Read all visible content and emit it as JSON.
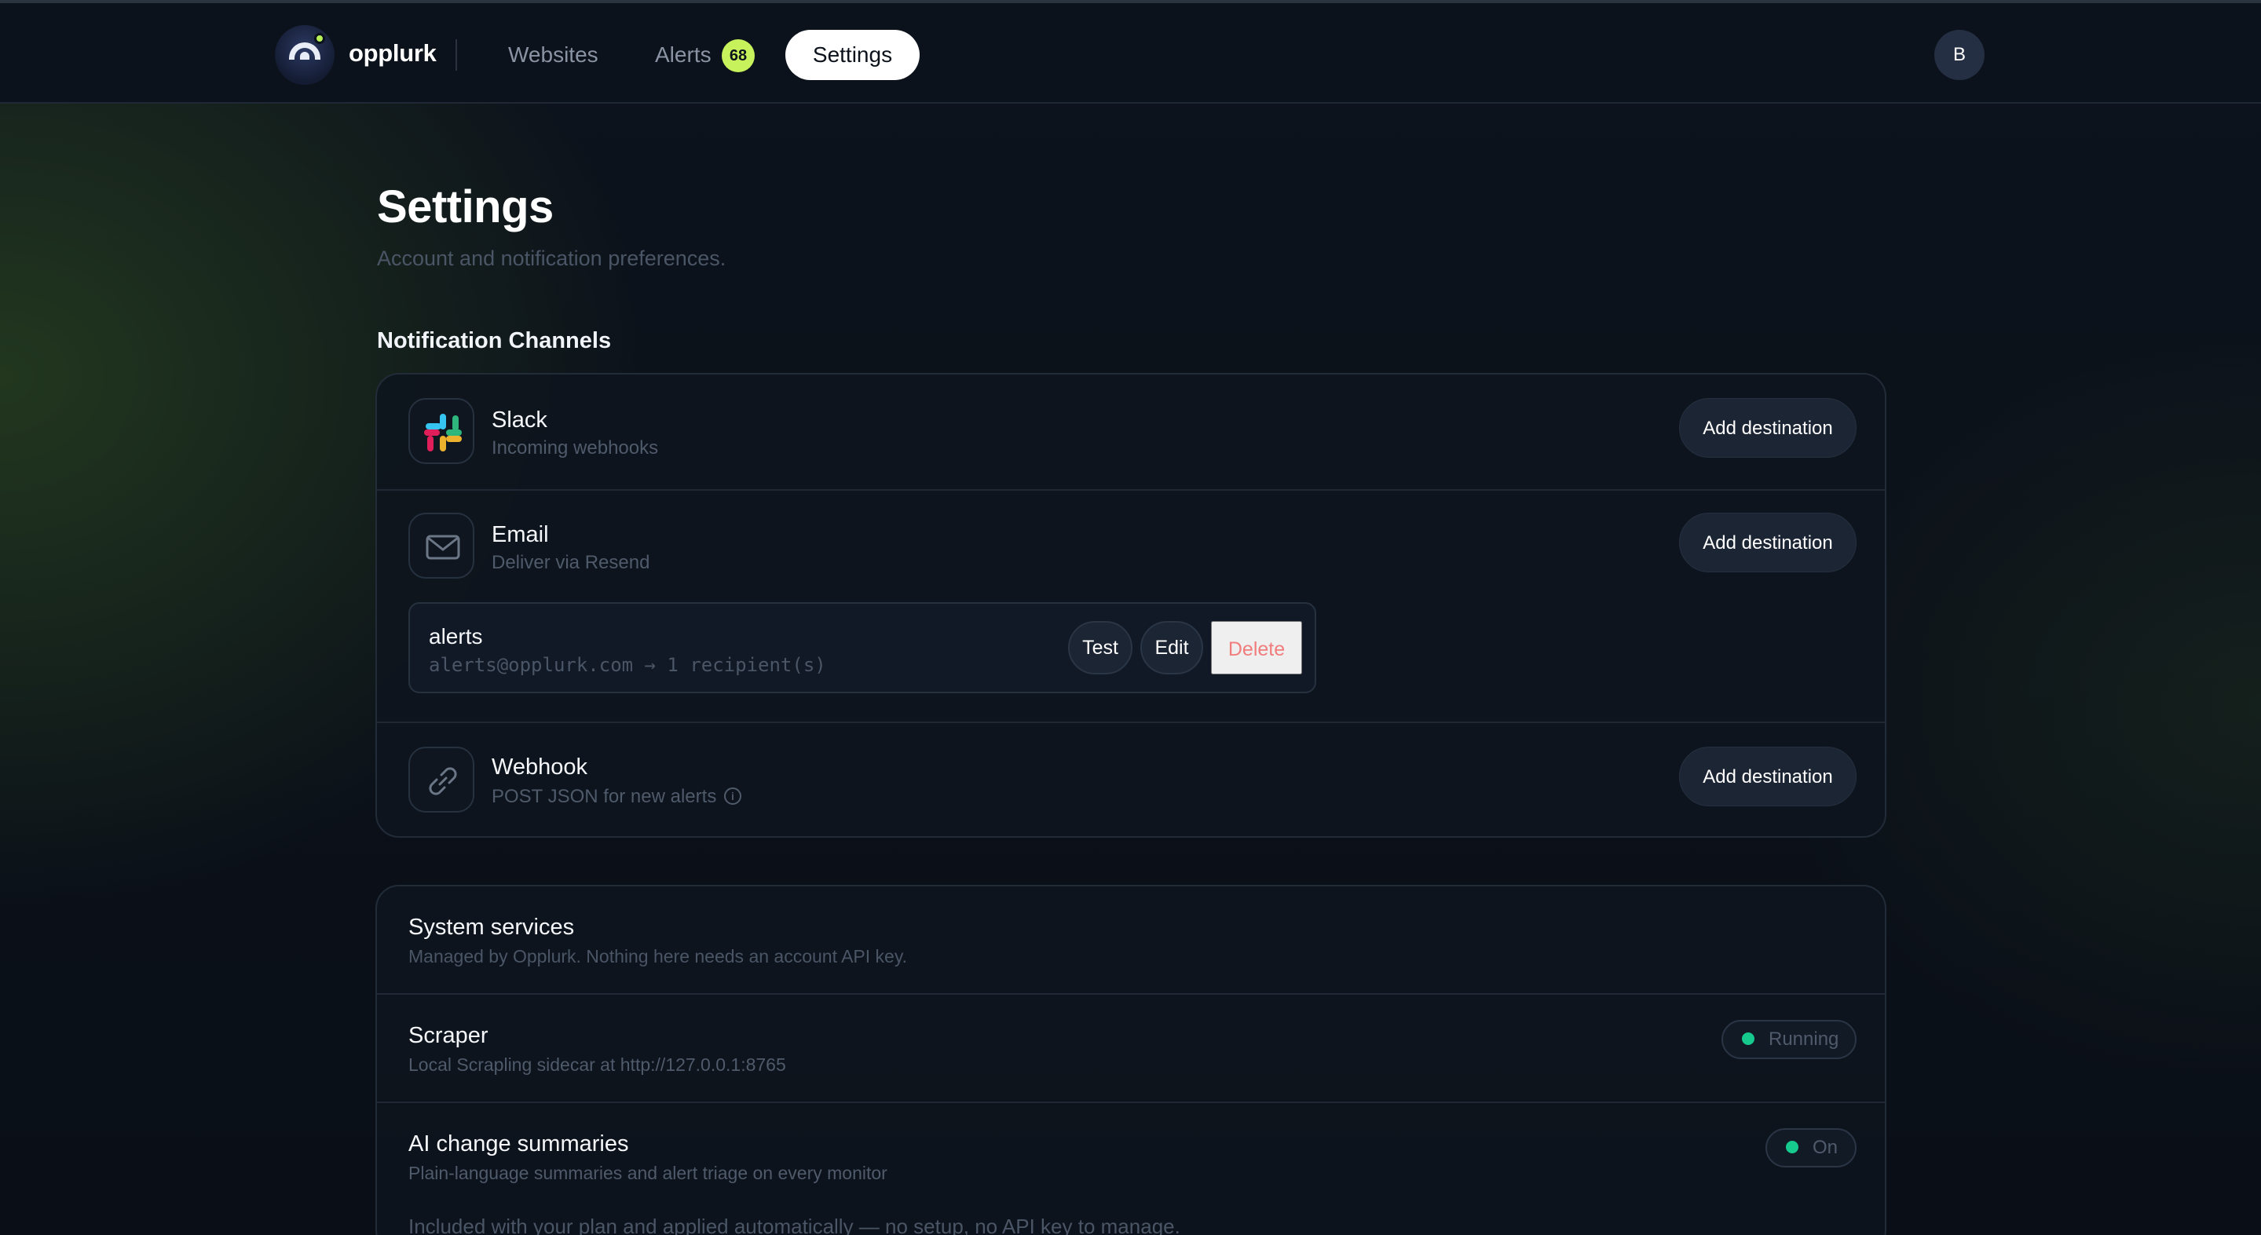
{
  "nav": {
    "brand": "opplurk",
    "links": [
      {
        "label": "Websites"
      },
      {
        "label": "Alerts",
        "badge": "68"
      },
      {
        "label": "Settings",
        "active": true
      }
    ],
    "avatar_initial": "B",
    "badge_color": "#c7f25c"
  },
  "page": {
    "title": "Settings",
    "subtitle": "Account and notification preferences."
  },
  "notification_channels": {
    "heading": "Notification Channels",
    "channels": [
      {
        "name": "Slack",
        "description": "Incoming webhooks",
        "action": "Add destination",
        "icon": "slack-icon"
      },
      {
        "name": "Email",
        "description": "Deliver via Resend",
        "action": "Add destination",
        "icon": "mail-icon",
        "destinations": [
          {
            "name": "alerts",
            "meta": "alerts@opplurk.com → 1 recipient(s)",
            "test_label": "Test",
            "edit_label": "Edit",
            "delete_label": "Delete"
          }
        ]
      },
      {
        "name": "Webhook",
        "description": "POST JSON for new alerts",
        "action": "Add destination",
        "icon": "link-icon"
      }
    ]
  },
  "system_services": {
    "title": "System services",
    "description": "Managed by Opplurk. Nothing here needs an account API key.",
    "services": [
      {
        "name": "Scraper",
        "description": "Local Scrapling sidecar at http://127.0.0.1:8765",
        "status": "Running",
        "status_color": "#16c98d"
      },
      {
        "name": "AI change summaries",
        "description": "Plain-language summaries and alert triage on every monitor",
        "status": "On",
        "status_color": "#16c98d",
        "note": "Included with your plan and applied automatically — no setup, no API key to manage."
      }
    ]
  },
  "colors": {
    "accent": "#c7f25c",
    "danger": "#f07c7c",
    "success": "#16c98d"
  }
}
